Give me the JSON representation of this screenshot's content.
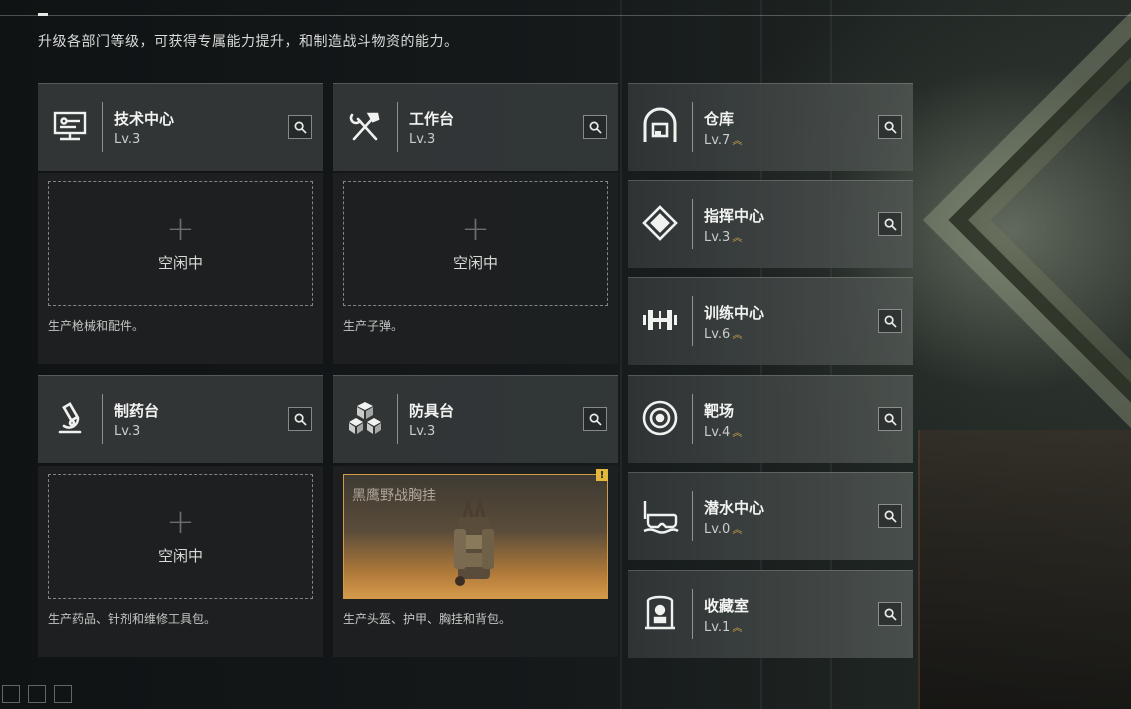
{
  "header": {
    "subtitle": "升级各部门等级，可获得专属能力提升，和制造战斗物资的能力。"
  },
  "departments": [
    {
      "name": "技术中心",
      "level": "Lv.3",
      "icon": "computer-icon",
      "upgrade": false
    },
    {
      "name": "工作台",
      "level": "Lv.3",
      "icon": "tools-icon",
      "upgrade": false
    },
    {
      "name": "制药台",
      "level": "Lv.3",
      "icon": "microscope-icon",
      "upgrade": false
    },
    {
      "name": "防具台",
      "level": "Lv.3",
      "icon": "boxes-icon",
      "upgrade": false
    },
    {
      "name": "仓库",
      "level": "Lv.7",
      "icon": "warehouse-icon",
      "upgrade": true
    },
    {
      "name": "指挥中心",
      "level": "Lv.3",
      "icon": "command-icon",
      "upgrade": true
    },
    {
      "name": "训练中心",
      "level": "Lv.6",
      "icon": "dumbbell-icon",
      "upgrade": true
    },
    {
      "name": "靶场",
      "level": "Lv.4",
      "icon": "target-icon",
      "upgrade": true
    },
    {
      "name": "潜水中心",
      "level": "Lv.0",
      "icon": "goggles-icon",
      "upgrade": true
    },
    {
      "name": "收藏室",
      "level": "Lv.1",
      "icon": "display-case-icon",
      "upgrade": true
    }
  ],
  "slots": [
    {
      "status": "空闲中",
      "desc": "生产枪械和配件。"
    },
    {
      "status": "空闲中",
      "desc": "生产子弹。"
    },
    {
      "status": "空闲中",
      "desc": "生产药品、针剂和维修工具包。"
    },
    {
      "item_name": "黑鹰野战胸挂",
      "badge": "!",
      "desc": "生产头盔、护甲、胸挂和背包。"
    }
  ],
  "colors": {
    "accent_gold": "#d29a45",
    "upgrade_chevron": "#c9a24a"
  }
}
